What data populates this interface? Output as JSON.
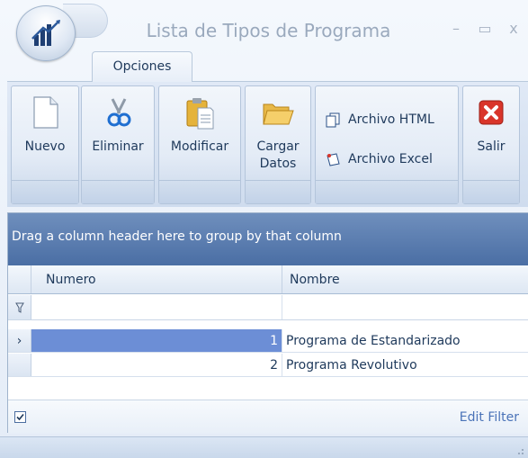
{
  "window": {
    "title": "Lista de Tipos de Programa",
    "minimize": "–",
    "maximize": "▭",
    "close": "x"
  },
  "ribbon": {
    "tab_label": "Opciones",
    "buttons": {
      "nuevo": "Nuevo",
      "eliminar": "Eliminar",
      "modificar": "Modificar",
      "cargar_line1": "Cargar",
      "cargar_line2": "Datos",
      "archivo_html": "Archivo HTML",
      "archivo_excel": "Archivo Excel",
      "salir": "Salir"
    }
  },
  "grid": {
    "group_panel_text": "Drag a column header here to group by that column",
    "columns": [
      "Numero",
      "Nombre"
    ],
    "rows": [
      {
        "numero": "1",
        "nombre": "Programa de Estandarizado",
        "selected": true
      },
      {
        "numero": "2",
        "nombre": "Programa Revolutivo",
        "selected": false
      }
    ],
    "edit_filter_label": "Edit Filter"
  },
  "colors": {
    "group_panel": "#5a7db0",
    "selected_row": "#6c8ed6",
    "salir_red": "#d9352a"
  }
}
